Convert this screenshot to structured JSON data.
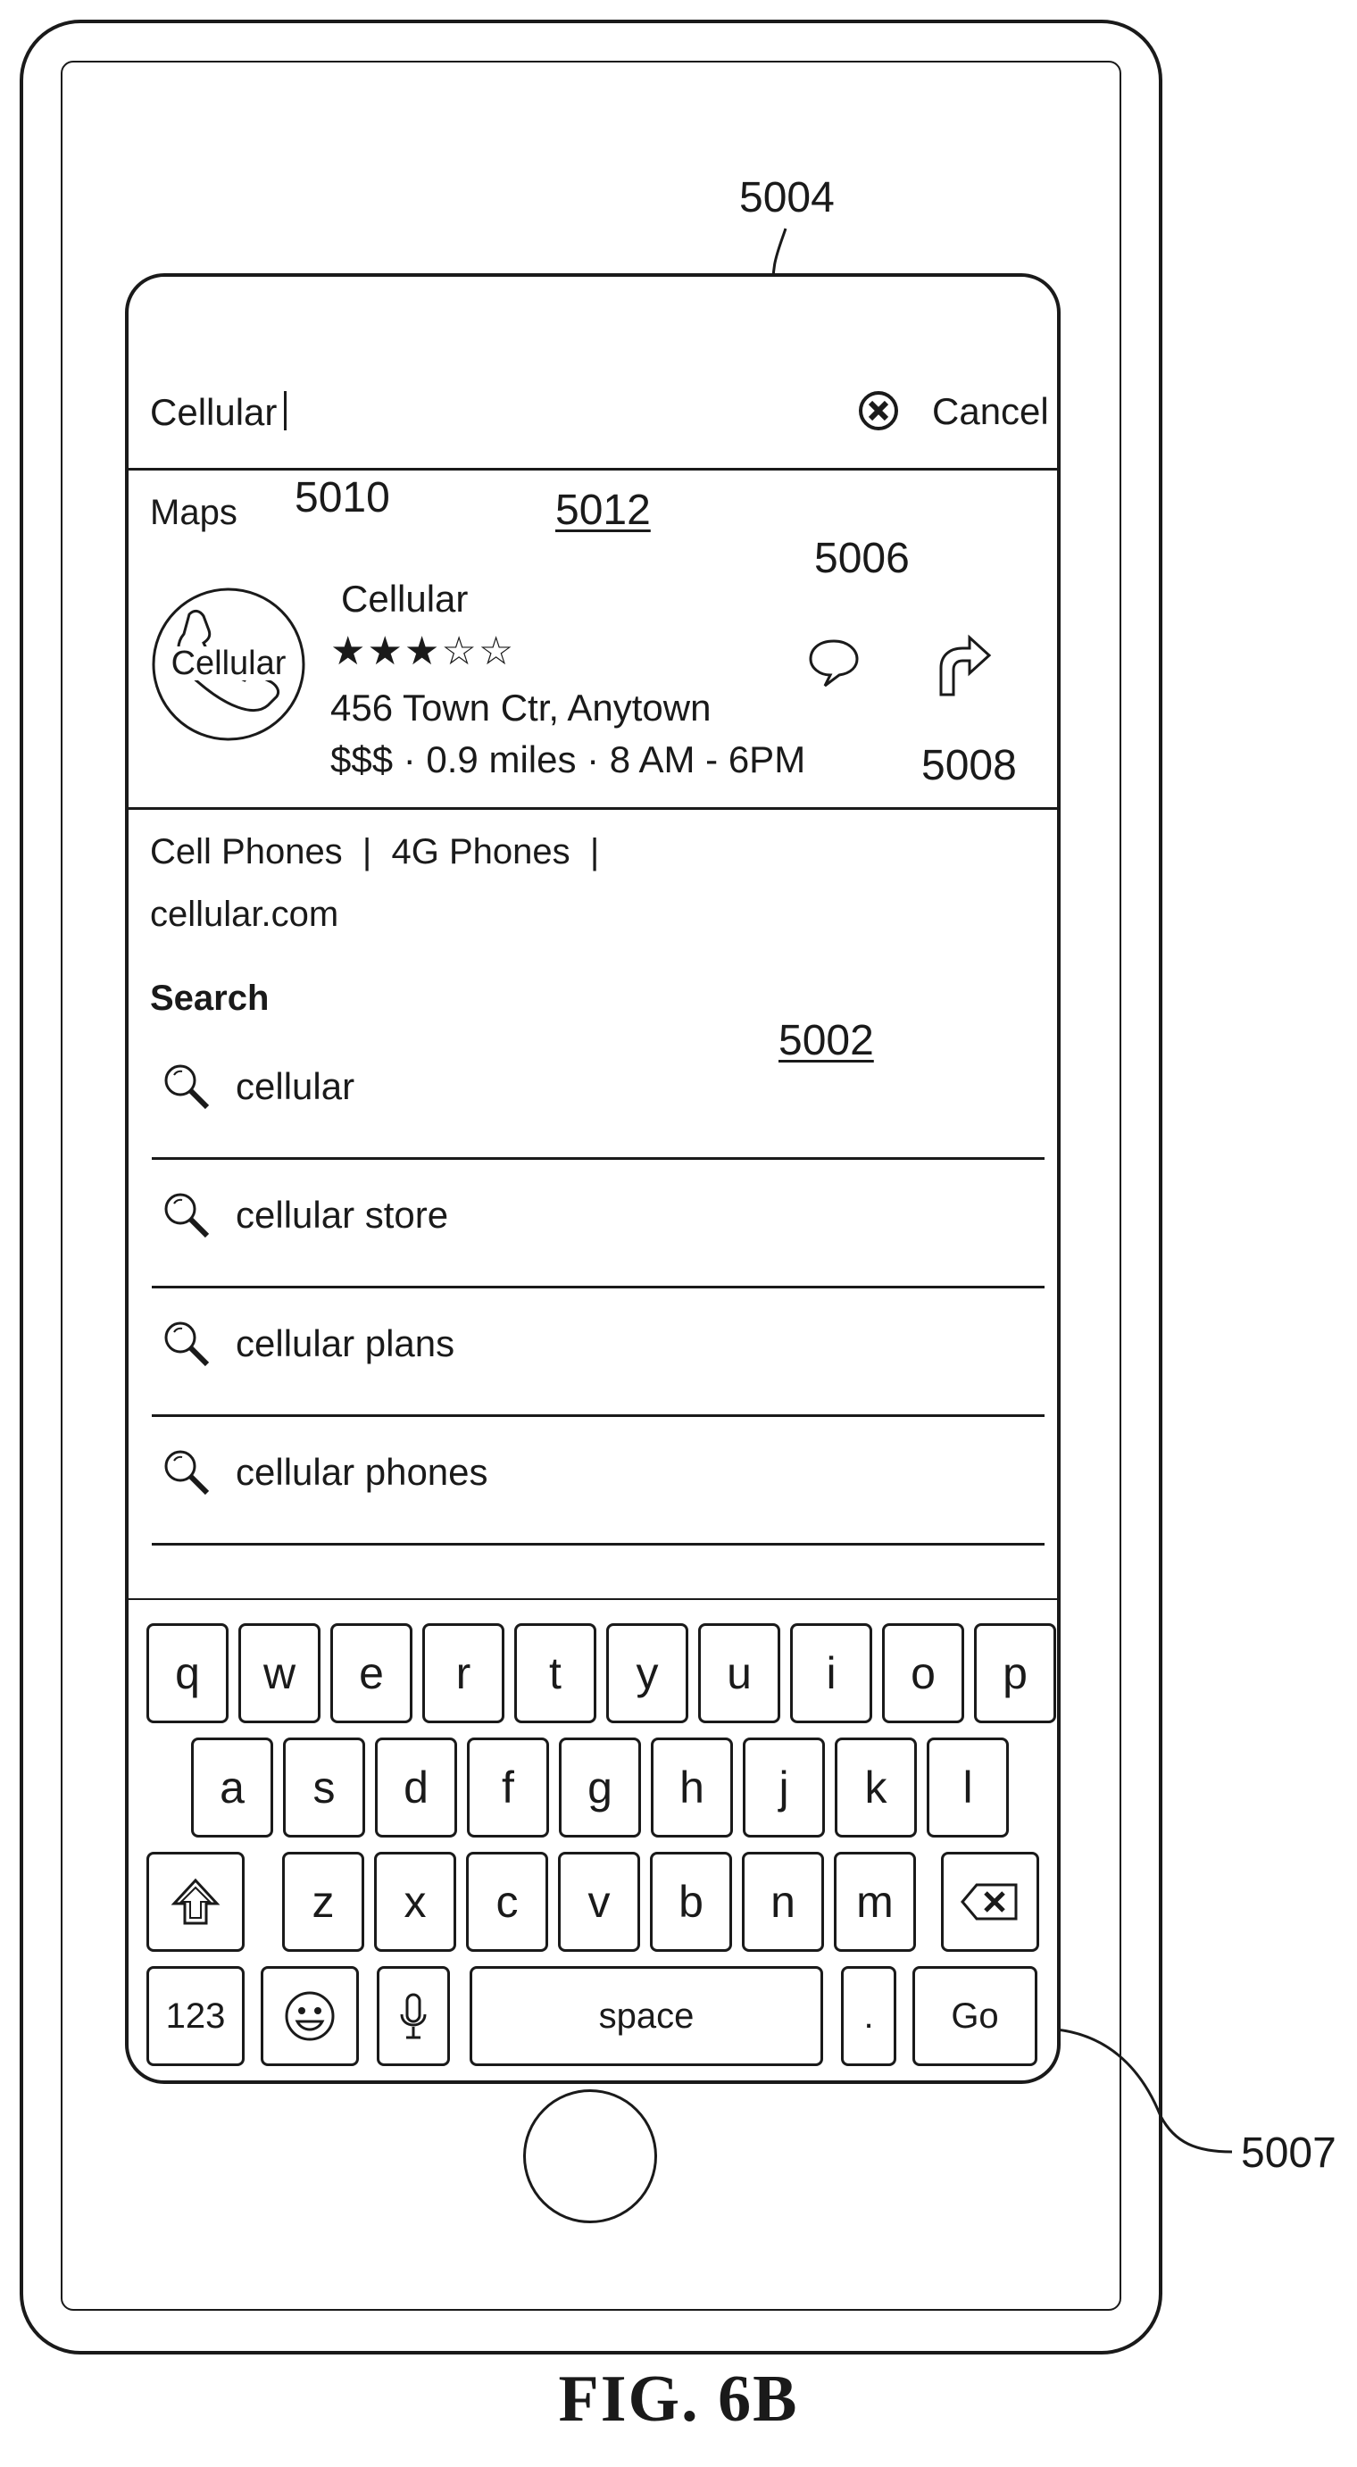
{
  "callouts": {
    "c5004": "5004",
    "c5010": "5010",
    "c5012": "5012",
    "c5006": "5006",
    "c5008": "5008",
    "c5002": "5002",
    "c5007": "5007"
  },
  "search_bar": {
    "value": "Cellular",
    "cancel_label": "Cancel"
  },
  "maps_result": {
    "section_label": "Maps",
    "icon_text": "Cellular",
    "name": "Cellular",
    "rating": 3,
    "rating_max": 5,
    "address": "456 Town Ctr, Anytown",
    "details": "$$$ · 0.9 miles · 8 AM - 6PM"
  },
  "web_result": {
    "links": "Cell Phones  |  4G Phones  |",
    "url": "cellular.com"
  },
  "search_section": {
    "label": "Search",
    "suggestions": [
      "cellular",
      "cellular store",
      "cellular plans",
      "cellular phones"
    ]
  },
  "keyboard": {
    "row1": [
      "q",
      "w",
      "e",
      "r",
      "t",
      "y",
      "u",
      "i",
      "o",
      "p"
    ],
    "row2": [
      "a",
      "s",
      "d",
      "f",
      "g",
      "h",
      "j",
      "k",
      "l"
    ],
    "row3": [
      "z",
      "x",
      "c",
      "v",
      "b",
      "n",
      "m"
    ],
    "numbers_label": "123",
    "space_label": "space",
    "period_label": ".",
    "go_label": "Go"
  },
  "figure_label": "FIG. 6B"
}
